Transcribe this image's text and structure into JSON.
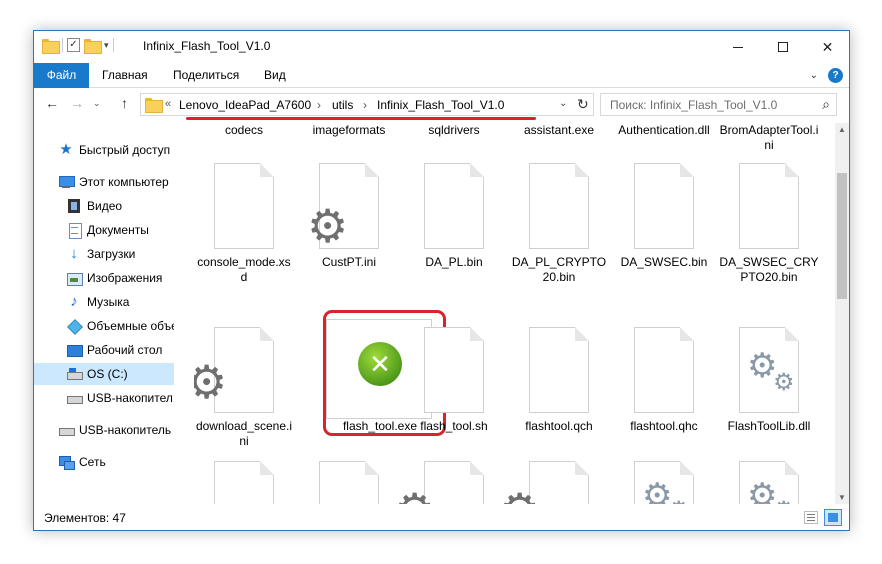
{
  "window": {
    "title": "Infinix_Flash_Tool_V1.0",
    "controls": {
      "minimize": "",
      "maximize": "",
      "close": "✕"
    }
  },
  "ribbon": {
    "tabs": [
      "Файл",
      "Главная",
      "Поделиться",
      "Вид"
    ],
    "help": "?"
  },
  "address": {
    "overflow": "«",
    "crumbs": [
      "Lenovo_IdeaPad_A7600",
      "utils",
      "Infinix_Flash_Tool_V1.0"
    ],
    "separator": "›"
  },
  "search": {
    "placeholder": "Поиск: Infinix_Flash_Tool_V1.0"
  },
  "sidebar": {
    "items": [
      {
        "label": "Быстрый доступ",
        "icon": "star-icon"
      },
      {
        "label": "Этот компьютер",
        "icon": "computer-icon"
      },
      {
        "label": "Видео",
        "icon": "video-icon"
      },
      {
        "label": "Документы",
        "icon": "documents-icon"
      },
      {
        "label": "Загрузки",
        "icon": "downloads-icon"
      },
      {
        "label": "Изображения",
        "icon": "pictures-icon"
      },
      {
        "label": "Музыка",
        "icon": "music-icon"
      },
      {
        "label": "Объемные объе",
        "icon": "3d-objects-icon"
      },
      {
        "label": "Рабочий стол",
        "icon": "desktop-icon"
      },
      {
        "label": "OS (C:)",
        "icon": "drive-icon",
        "selected": true
      },
      {
        "label": "USB-накопител",
        "icon": "usb-drive-icon"
      },
      {
        "label": "USB-накопитель (",
        "icon": "usb-drive-icon"
      },
      {
        "label": "Сеть",
        "icon": "network-icon"
      }
    ]
  },
  "files": {
    "row0": [
      "codecs",
      "imageformats",
      "sqldrivers",
      "assistant.exe",
      "Authentication.dll",
      "BromAdapterTool.ini"
    ],
    "row1": [
      "console_mode.xsd",
      "CustPT.ini",
      "DA_PL.bin",
      "DA_PL_CRYPTO20.bin",
      "DA_SWSEC.bin",
      "DA_SWSEC_CRYPTO20.bin"
    ],
    "row2": [
      "download_scene.ini",
      "flash_tool.exe",
      "flash_tool.sh",
      "flashtool.qch",
      "flashtool.qhc",
      "FlashToolLib.dll"
    ],
    "selected": "flash_tool.exe"
  },
  "status": {
    "items_count": "Элементов: 47"
  },
  "colors": {
    "accent": "#1979ca",
    "highlight": "#d9232d",
    "selection": "#cce8ff"
  }
}
